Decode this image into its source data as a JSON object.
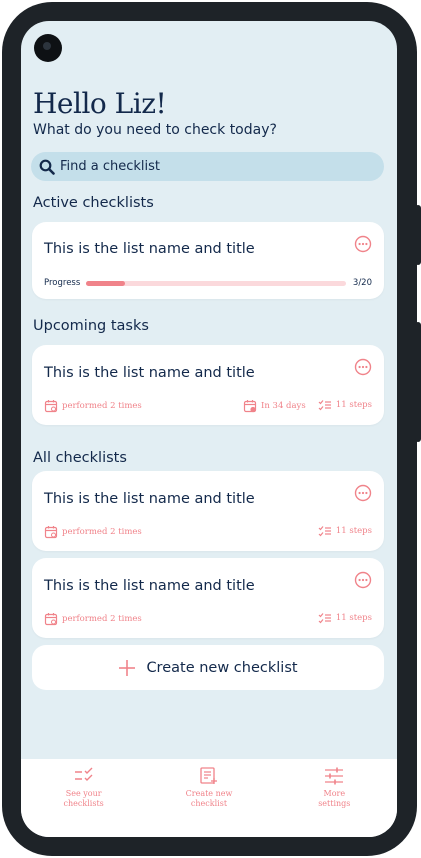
{
  "greeting": {
    "title": "Hello Liz!",
    "subtitle": "What do you need to check today?"
  },
  "search": {
    "placeholder": "Find a checklist"
  },
  "sections": {
    "active": "Active checklists",
    "upcoming": "Upcoming tasks",
    "all": "All checklists"
  },
  "active_card": {
    "title": "This is the list name and title",
    "progress_label": "Progress",
    "progress_count": "3/20",
    "progress_fraction": 0.15
  },
  "upcoming_card": {
    "title": "This is the list name and title",
    "performed": "performed 2 times",
    "due": "In 34 days",
    "steps": "11 steps"
  },
  "all_cards": [
    {
      "title": "This is the list name and title",
      "performed": "performed 2 times",
      "steps": "11 steps"
    },
    {
      "title": "This is the list name and title",
      "performed": "performed 2 times",
      "steps": "11 steps"
    }
  ],
  "create_button": {
    "label": "Create new checklist"
  },
  "bottom_nav": [
    {
      "label": "See your\nchecklists",
      "icon": "checklist-icon"
    },
    {
      "label": "Create new\nchecklist",
      "icon": "new-checklist-icon"
    },
    {
      "label": "More\nsettings",
      "icon": "settings-sliders-icon"
    }
  ],
  "colors": {
    "accent": "#f0838a",
    "navy": "#13294b",
    "background": "#e2eef3",
    "search": "#c4dfea"
  }
}
